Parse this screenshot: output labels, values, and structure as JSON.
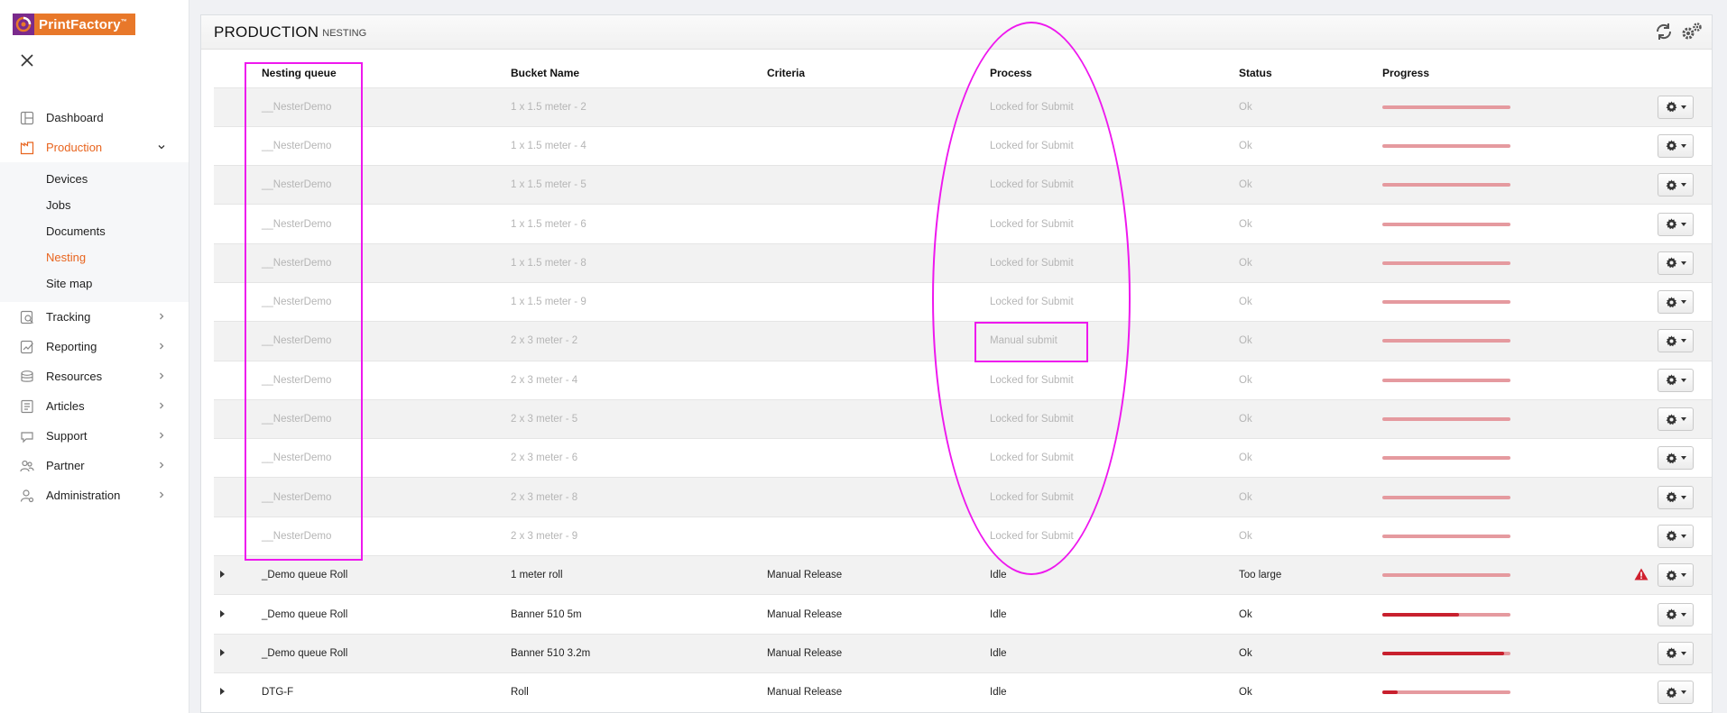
{
  "app": {
    "logo_text": "PrintFactory",
    "logo_tm": "™"
  },
  "sidebar": {
    "items": [
      {
        "label": "Dashboard",
        "icon": "dashboard-icon",
        "expandable": false,
        "active": false
      },
      {
        "label": "Production",
        "icon": "production-icon",
        "expandable": true,
        "expanded": true,
        "active": true,
        "children": [
          {
            "label": "Devices",
            "active": false
          },
          {
            "label": "Jobs",
            "active": false
          },
          {
            "label": "Documents",
            "active": false
          },
          {
            "label": "Nesting",
            "active": true
          },
          {
            "label": "Site map",
            "active": false
          }
        ]
      },
      {
        "label": "Tracking",
        "icon": "tracking-icon",
        "expandable": true
      },
      {
        "label": "Reporting",
        "icon": "reporting-icon",
        "expandable": true
      },
      {
        "label": "Resources",
        "icon": "resources-icon",
        "expandable": true
      },
      {
        "label": "Articles",
        "icon": "articles-icon",
        "expandable": true
      },
      {
        "label": "Support",
        "icon": "support-icon",
        "expandable": true
      },
      {
        "label": "Partner",
        "icon": "partner-icon",
        "expandable": true
      },
      {
        "label": "Administration",
        "icon": "administration-icon",
        "expandable": true
      }
    ]
  },
  "header": {
    "title": "PRODUCTION",
    "subtitle": "NESTING"
  },
  "table": {
    "columns": [
      "Nesting queue",
      "Bucket Name",
      "Criteria",
      "Process",
      "Status",
      "Progress"
    ],
    "rows": [
      {
        "expandable": false,
        "queue": "__NesterDemo",
        "bucket": "1 x 1.5 meter - 2",
        "criteria": "",
        "process": "Locked for Submit",
        "status": "Ok",
        "progress": 1.0,
        "filled": false,
        "warning": false
      },
      {
        "expandable": false,
        "queue": "__NesterDemo",
        "bucket": "1 x 1.5 meter - 4",
        "criteria": "",
        "process": "Locked for Submit",
        "status": "Ok",
        "progress": 1.0,
        "filled": false,
        "warning": false
      },
      {
        "expandable": false,
        "queue": "__NesterDemo",
        "bucket": "1 x 1.5 meter - 5",
        "criteria": "",
        "process": "Locked for Submit",
        "status": "Ok",
        "progress": 1.0,
        "filled": false,
        "warning": false
      },
      {
        "expandable": false,
        "queue": "__NesterDemo",
        "bucket": "1 x 1.5 meter - 6",
        "criteria": "",
        "process": "Locked for Submit",
        "status": "Ok",
        "progress": 1.0,
        "filled": false,
        "warning": false
      },
      {
        "expandable": false,
        "queue": "__NesterDemo",
        "bucket": "1 x 1.5 meter - 8",
        "criteria": "",
        "process": "Locked for Submit",
        "status": "Ok",
        "progress": 1.0,
        "filled": false,
        "warning": false
      },
      {
        "expandable": false,
        "queue": "__NesterDemo",
        "bucket": "1 x 1.5 meter - 9",
        "criteria": "",
        "process": "Locked for Submit",
        "status": "Ok",
        "progress": 1.0,
        "filled": false,
        "warning": false
      },
      {
        "expandable": false,
        "queue": "__NesterDemo",
        "bucket": "2 x 3 meter - 2",
        "criteria": "",
        "process": "Manual submit",
        "status": "Ok",
        "progress": 1.0,
        "filled": false,
        "warning": false
      },
      {
        "expandable": false,
        "queue": "__NesterDemo",
        "bucket": "2 x 3 meter - 4",
        "criteria": "",
        "process": "Locked for Submit",
        "status": "Ok",
        "progress": 1.0,
        "filled": false,
        "warning": false
      },
      {
        "expandable": false,
        "queue": "__NesterDemo",
        "bucket": "2 x 3 meter - 5",
        "criteria": "",
        "process": "Locked for Submit",
        "status": "Ok",
        "progress": 1.0,
        "filled": false,
        "warning": false
      },
      {
        "expandable": false,
        "queue": "__NesterDemo",
        "bucket": "2 x 3 meter - 6",
        "criteria": "",
        "process": "Locked for Submit",
        "status": "Ok",
        "progress": 1.0,
        "filled": false,
        "warning": false
      },
      {
        "expandable": false,
        "queue": "__NesterDemo",
        "bucket": "2 x 3 meter - 8",
        "criteria": "",
        "process": "Locked for Submit",
        "status": "Ok",
        "progress": 1.0,
        "filled": false,
        "warning": false
      },
      {
        "expandable": false,
        "queue": "__NesterDemo",
        "bucket": "2 x 3 meter - 9",
        "criteria": "",
        "process": "Locked for Submit",
        "status": "Ok",
        "progress": 1.0,
        "filled": false,
        "warning": false
      },
      {
        "expandable": true,
        "queue": "_Demo queue Roll",
        "bucket": "1 meter roll",
        "criteria": "Manual Release",
        "process": "Idle",
        "status": "Too large",
        "progress": 0.0,
        "filled": true,
        "warning": true
      },
      {
        "expandable": true,
        "queue": "_Demo queue Roll",
        "bucket": "Banner 510 5m",
        "criteria": "Manual Release",
        "process": "Idle",
        "status": "Ok",
        "progress": 0.6,
        "filled": true,
        "warning": false
      },
      {
        "expandable": true,
        "queue": "_Demo queue Roll",
        "bucket": "Banner 510 3.2m",
        "criteria": "Manual Release",
        "process": "Idle",
        "status": "Ok",
        "progress": 0.95,
        "filled": true,
        "warning": false
      },
      {
        "expandable": true,
        "queue": "DTG-F",
        "bucket": "Roll",
        "criteria": "Manual Release",
        "process": "Idle",
        "status": "Ok",
        "progress": 0.12,
        "filled": true,
        "warning": false
      }
    ]
  },
  "colors": {
    "brand_orange": "#e8782a",
    "active_nav": "#e8641e",
    "progress_track": "#e59a9f",
    "progress_fill": "#c8202e",
    "annotation": "#ee18ee",
    "warning": "#d0202e"
  }
}
